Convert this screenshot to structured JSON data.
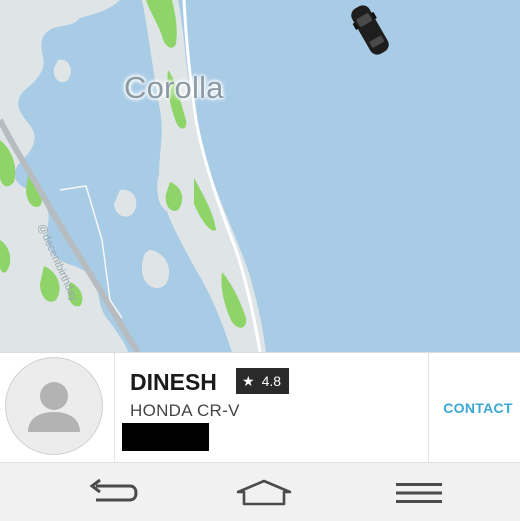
{
  "map": {
    "place_label": "Corolla",
    "watermark": "@decentbirthday",
    "icons": [
      "car-icon"
    ],
    "colors": {
      "water": "#a8cbe6",
      "land": "#dfe5e6",
      "park": "#8fd468",
      "road": "#b6bcc0"
    }
  },
  "driver": {
    "name": "DINESH",
    "rating": "4.8",
    "rating_icon": "star-icon",
    "vehicle": "HONDA CR-V",
    "plate_redacted": true
  },
  "actions": {
    "contact_label": "CONTACT",
    "accent": "#3aa7d6"
  },
  "nav": {
    "icons": [
      "back-icon",
      "home-icon",
      "menu-icon"
    ]
  }
}
